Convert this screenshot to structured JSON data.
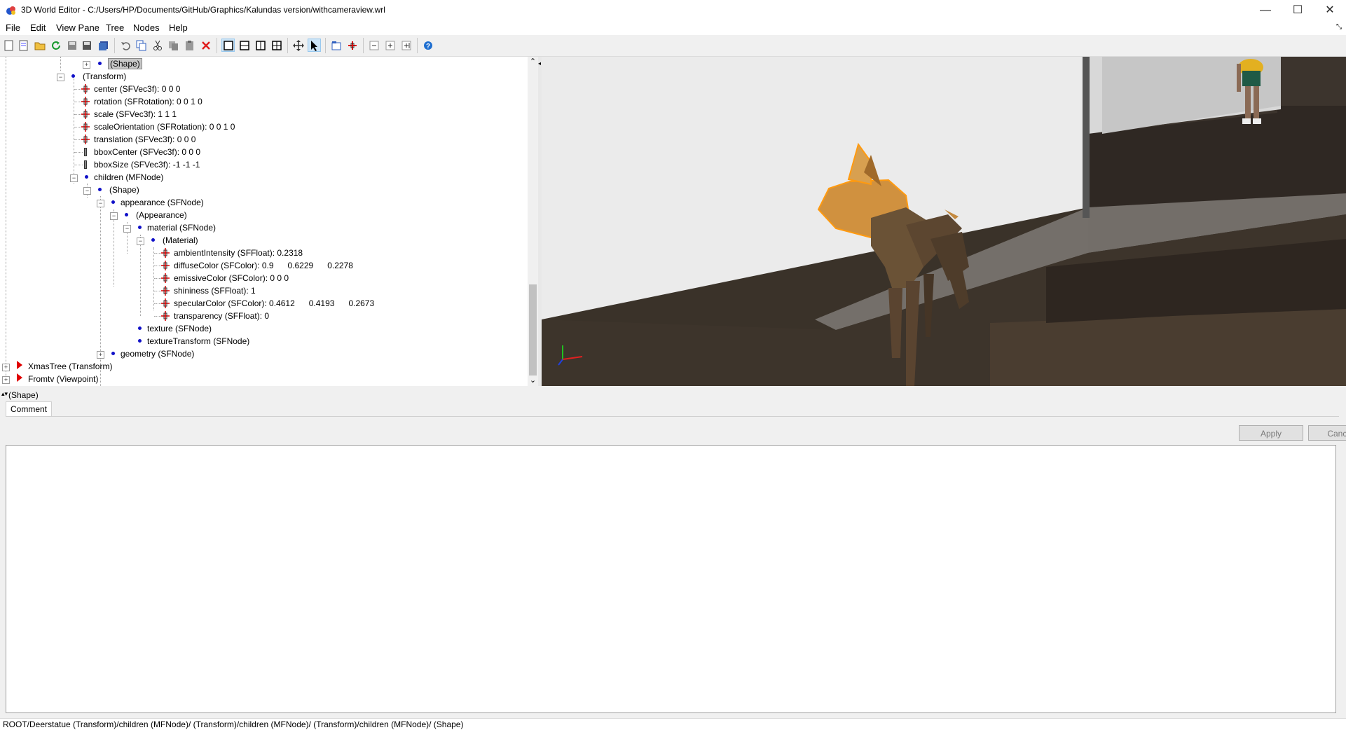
{
  "window": {
    "title": "3D World Editor - C:/Users/HP/Documents/GitHub/Graphics/Kalundas version/withcameraview.wrl",
    "minimize_glyph": "—",
    "maximize_glyph": "☐",
    "close_glyph": "✕"
  },
  "menu": {
    "items": [
      "File",
      "Edit",
      "View Pane",
      "Tree",
      "Nodes",
      "Help"
    ]
  },
  "toolbar": {
    "icons": [
      "new-icon",
      "new-template-icon",
      "open-icon",
      "reload-icon",
      "save-icon",
      "save-as-icon",
      "save-all-icon",
      "undo-icon",
      "copy-icon",
      "cut-icon",
      "copy-alt-icon",
      "paste-icon",
      "delete-icon",
      "single-pane-icon",
      "split-horizontal-icon",
      "split-vertical-icon",
      "quad-pane-icon",
      "move-icon",
      "select-pointer-icon",
      "node-icon",
      "add-field-icon",
      "collapse-icon",
      "expand-icon",
      "expand-all-icon",
      "help-icon"
    ],
    "active": [
      "single-pane-icon",
      "select-pointer-icon"
    ]
  },
  "tree": {
    "nodes": [
      {
        "text": "(Shape)",
        "selected": true
      },
      {
        "text": "(Transform)"
      },
      {
        "text": "center (SFVec3f): 0  0  0"
      },
      {
        "text": "rotation (SFRotation): 0  0  1  0"
      },
      {
        "text": "scale (SFVec3f): 1  1  1"
      },
      {
        "text": "scaleOrientation (SFRotation): 0  0  1  0"
      },
      {
        "text": "translation (SFVec3f): 0  0  0"
      },
      {
        "text": "bboxCenter (SFVec3f): 0  0  0"
      },
      {
        "text": "bboxSize (SFVec3f): -1 -1 -1"
      },
      {
        "text": "children (MFNode)"
      },
      {
        "text": "(Shape)"
      },
      {
        "text": "appearance (SFNode)"
      },
      {
        "text": "(Appearance)"
      },
      {
        "text": "material (SFNode)"
      },
      {
        "text": "(Material)"
      },
      {
        "text": "ambientIntensity (SFFloat): 0.2318"
      },
      {
        "text": "diffuseColor (SFColor): 0.9      0.6229      0.2278"
      },
      {
        "text": "emissiveColor (SFColor): 0  0  0"
      },
      {
        "text": "shininess (SFFloat): 1"
      },
      {
        "text": "specularColor (SFColor): 0.4612      0.4193      0.2673"
      },
      {
        "text": "transparency (SFFloat): 0"
      },
      {
        "text": "texture (SFNode)"
      },
      {
        "text": "textureTransform (SFNode)"
      },
      {
        "text": "geometry (SFNode)"
      },
      {
        "text": "XmasTree (Transform)"
      },
      {
        "text": "Fromtv (Viewpoint)"
      }
    ]
  },
  "scrollbar": {
    "up_glyph": "⌃",
    "down_glyph": "⌄"
  },
  "properties": {
    "node_label": "(Shape)",
    "tab": "Comment",
    "apply_label": "Apply",
    "cancel_label": "Cancel",
    "comment_value": ""
  },
  "status": {
    "path": "ROOT/Deerstatue (Transform)/children (MFNode)/ (Transform)/children (MFNode)/ (Transform)/children (MFNode)/ (Shape)"
  },
  "colors": {
    "field_icon": "#e00000",
    "node_dot": "#1010c8",
    "top_level_marker": "#e00000",
    "selected_bg": "#c8c8c8",
    "deer_body": "#c98a3c",
    "floor": "#3a3229"
  }
}
